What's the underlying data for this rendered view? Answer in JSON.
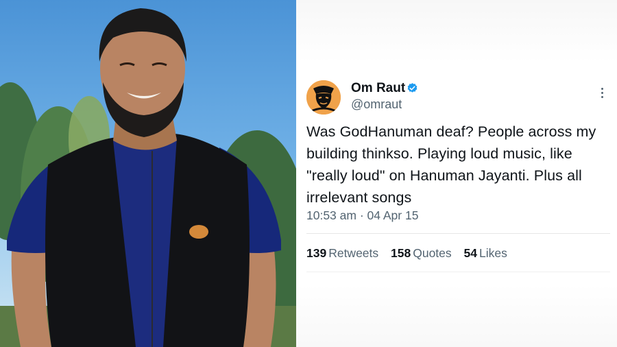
{
  "photo": {
    "description_icon": "person-photo"
  },
  "tweet": {
    "display_name": "Om Raut",
    "handle": "@omraut",
    "verified_icon": "verified-badge-icon",
    "more_icon": "more-options-icon",
    "text": "Was GodHanuman deaf? People across my building thinkso. Playing loud music, like \"really loud\" on Hanuman Jayanti. Plus all irrelevant songs",
    "timestamp": "10:53 am · 04 Apr 15",
    "stats": {
      "retweets_count": "139",
      "retweets_label": "Retweets",
      "quotes_count": "158",
      "quotes_label": "Quotes",
      "likes_count": "54",
      "likes_label": "Likes"
    }
  },
  "colors": {
    "verified": "#1d9bf0",
    "text_primary": "#0f1419",
    "text_secondary": "#536471",
    "avatar_bg": "#f0a24a"
  }
}
